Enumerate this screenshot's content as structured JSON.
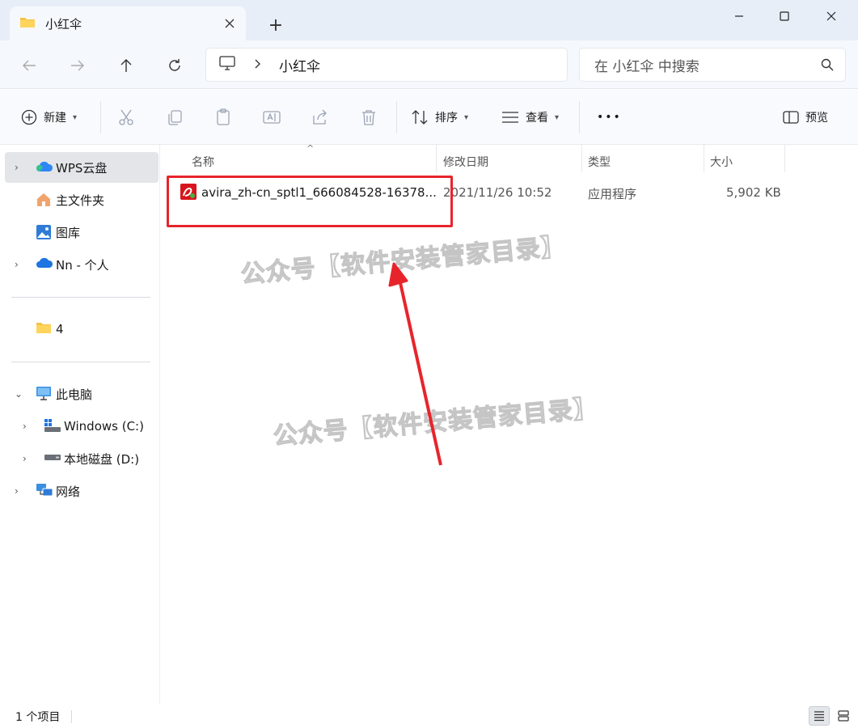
{
  "window": {
    "tab_title": "小红伞",
    "new_tab_label": "+"
  },
  "nav": {
    "breadcrumb": "小红伞",
    "search_placeholder": "在 小红伞 中搜索"
  },
  "toolbar": {
    "new_label": "新建",
    "sort_label": "排序",
    "view_label": "查看",
    "more_label": "•••",
    "preview_label": "预览"
  },
  "sidebar": {
    "items": [
      {
        "label": "WPS云盘",
        "icon": "wps-cloud-icon"
      },
      {
        "label": "主文件夹",
        "icon": "home-icon"
      },
      {
        "label": "图库",
        "icon": "gallery-icon"
      },
      {
        "label": "Nn - 个人",
        "icon": "onedrive-icon"
      },
      {
        "label": "4",
        "icon": "folder-icon"
      },
      {
        "label": "此电脑",
        "icon": "computer-icon"
      },
      {
        "label": "Windows (C:)",
        "icon": "windows-drive-icon"
      },
      {
        "label": "本地磁盘 (D:)",
        "icon": "drive-icon"
      },
      {
        "label": "网络",
        "icon": "network-icon"
      }
    ]
  },
  "columns": {
    "name": "名称",
    "modified": "修改日期",
    "type": "类型",
    "size": "大小"
  },
  "files": [
    {
      "name": "avira_zh-cn_sptl1_666084528-16378...",
      "modified": "2021/11/26 10:52",
      "type": "应用程序",
      "size": "5,902 KB",
      "icon": "avira-app-icon"
    }
  ],
  "watermarks": [
    "公众号【软件安装管家目录】",
    "公众号【软件安装管家目录】"
  ],
  "status": {
    "item_count": "1 个项目"
  },
  "colors": {
    "annotation_red": "#e8242b",
    "selection": "#e3e5e8",
    "titlebar": "#e8eef7"
  }
}
